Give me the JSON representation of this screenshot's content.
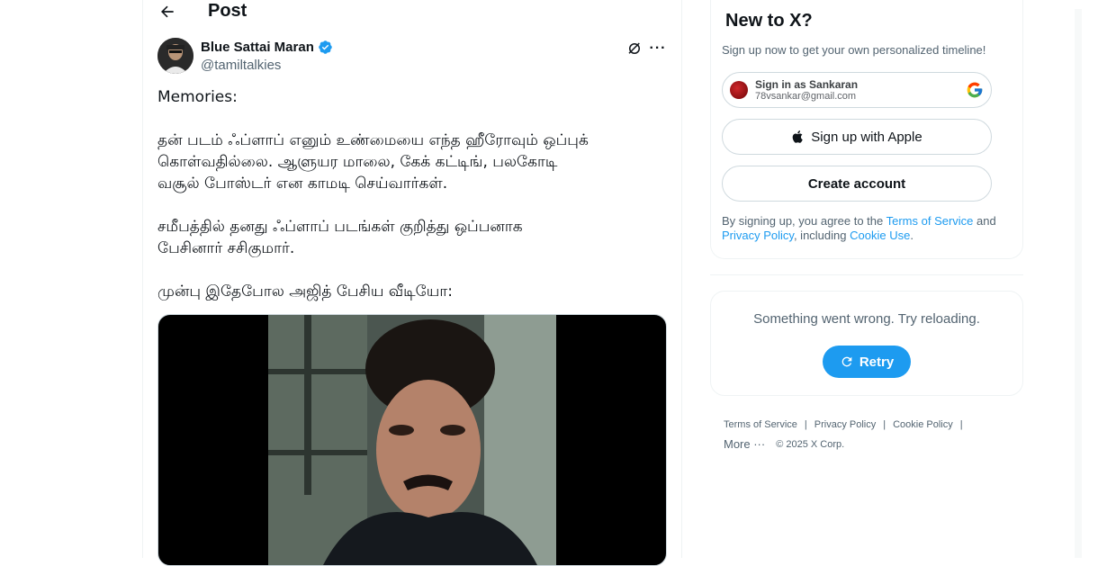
{
  "header": {
    "title": "Post"
  },
  "tweet": {
    "author_name": "Blue Sattai Maran",
    "author_handle": "@tamiltalkies",
    "lines": [
      "Memories:",
      "",
      "தன் படம் ஃப்ளாப் எனும் உண்மையை எந்த ஹீரோவும் ஒப்புக்",
      "கொள்வதில்லை. ஆளுயர மாலை, கேக் கட்டிங், பலகோடி",
      "வசூல் போஸ்டர் என காமடி செய்வார்கள்.",
      "",
      "சமீபத்தில் தனது ஃப்ளாப் படங்கள் குறித்து ஒப்பனாக",
      "பேசினார் சசிகுமார்.",
      "",
      "முன்பு இதேபோல அஜித் பேசிய வீடியோ:"
    ]
  },
  "signup": {
    "title": "New to X?",
    "subtitle": "Sign up now to get your own personalized timeline!",
    "google_line1": "Sign in as Sankaran",
    "google_line2": "78vsankar@gmail.com",
    "apple_label": "Sign up with Apple",
    "create_label": "Create account",
    "legal_pre": "By signing up, you agree to the ",
    "legal_tos": "Terms of Service",
    "legal_and": " and ",
    "legal_privacy": "Privacy Policy",
    "legal_incl": ", including ",
    "legal_cookie": "Cookie Use",
    "legal_end": "."
  },
  "error_card": {
    "message": "Something went wrong. Try reloading.",
    "retry_label": "Retry"
  },
  "footer": {
    "links": [
      "Terms of Service",
      "Privacy Policy",
      "Cookie Policy"
    ],
    "more": "More ···",
    "copyright": "© 2025 X Corp."
  },
  "colors": {
    "accent": "#1d9bf0",
    "text": "#0f1419",
    "secondary": "#536471"
  }
}
